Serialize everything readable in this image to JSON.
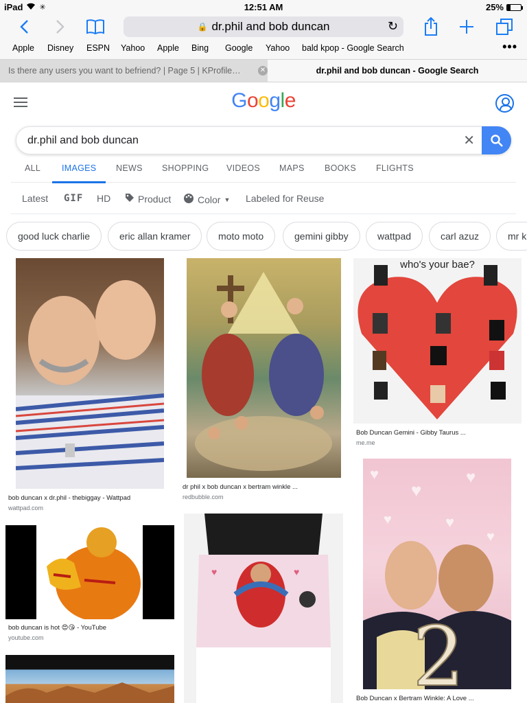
{
  "status": {
    "device": "iPad",
    "time": "12:51 AM",
    "battery": "25%"
  },
  "browser": {
    "url": "dr.phil and bob duncan",
    "bookmarks": [
      "Apple",
      "Disney",
      "ESPN",
      "Yahoo",
      "Apple",
      "Bing",
      "Google",
      "Yahoo",
      "bald kpop - Google Search"
    ],
    "tabs": [
      {
        "title": "Is there any users you want to befriend? | Page 5 | KProfile…",
        "active": false
      },
      {
        "title": "dr.phil and bob duncan - Google Search",
        "active": true
      }
    ]
  },
  "search": {
    "logo": "Google",
    "query": "dr.phil and bob duncan",
    "nav_tabs": [
      "ALL",
      "IMAGES",
      "NEWS",
      "SHOPPING",
      "VIDEOS",
      "MAPS",
      "BOOKS",
      "FLIGHTS"
    ],
    "active_tab": "IMAGES",
    "tools": [
      "Latest",
      "GIF",
      "HD",
      "Product",
      "Color",
      "Labeled for Reuse"
    ],
    "chips": [
      "good luck charlie",
      "eric allan kramer",
      "moto moto",
      "gemini gibby",
      "wattpad",
      "carl azuz",
      "mr k"
    ]
  },
  "results": [
    {
      "caption": "bob duncan x dr.phil - thebiggay - Wattpad",
      "source": "wattpad.com"
    },
    {
      "caption": "dr phil x bob duncan x bertram winkle ...",
      "source": "redbubble.com"
    },
    {
      "caption": "Bob Duncan Gemini - Gibby Taurus ...",
      "source": "me.me",
      "image_text": "who's your bae?"
    },
    {
      "caption": "bob duncan is hot 😍😘 - YouTube",
      "source": "youtube.com"
    },
    {
      "caption": "Bob Duncan x Bertram Winkle: A Love ...",
      "source": ""
    }
  ],
  "colors": {
    "accent": "#1a73e8",
    "search_button": "#4285f4",
    "ios_blue": "#1a7cf5"
  }
}
